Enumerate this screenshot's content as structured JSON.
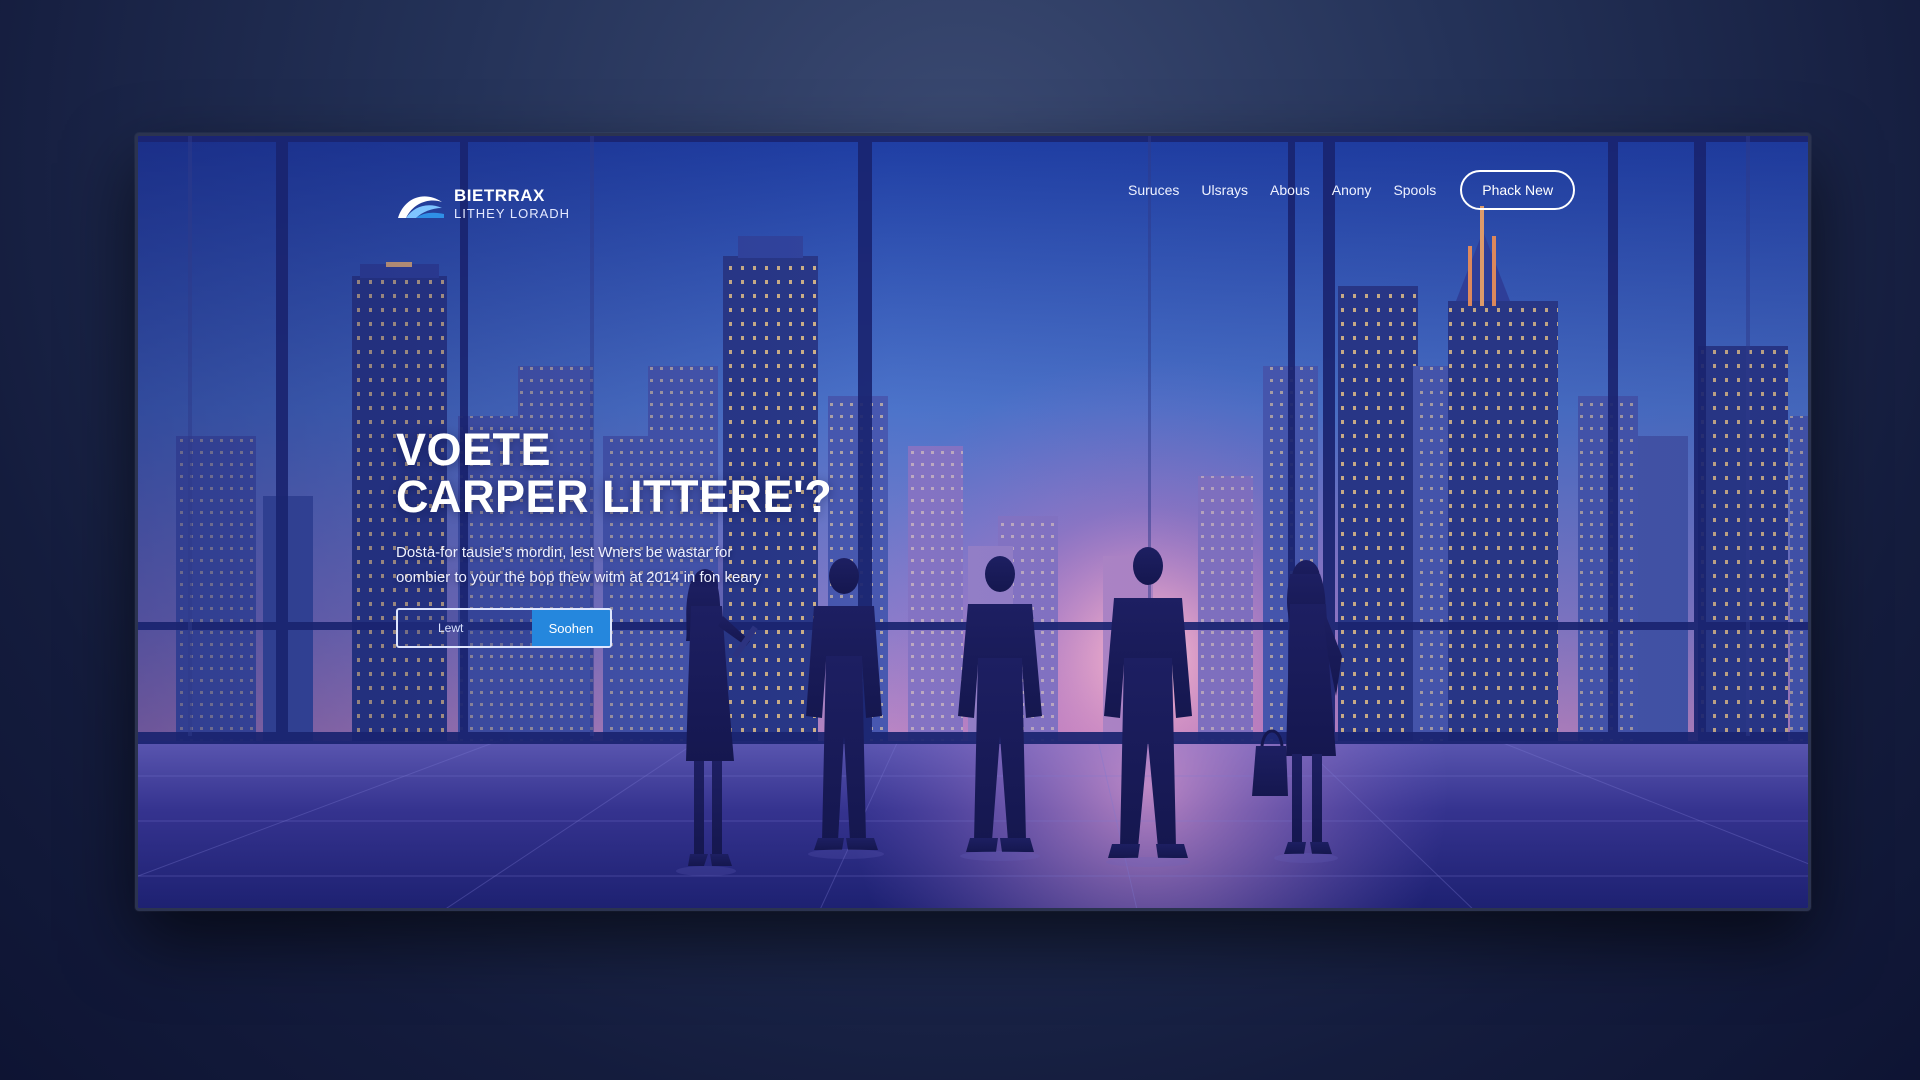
{
  "brand": {
    "name": "BIETRRAX",
    "tagline": "LITHEY LORADH"
  },
  "nav": {
    "items": [
      {
        "label": "Suruces"
      },
      {
        "label": "Ulsrays"
      },
      {
        "label": "Abous"
      },
      {
        "label": "Anony"
      },
      {
        "label": "Spools"
      }
    ],
    "cta_label": "Phack New"
  },
  "hero": {
    "title_line1": "VOETE",
    "title_line2": "CARPER LITTERE'?",
    "desc_line1": "Dosta-for tausie's mordin, lest Wners be wastar for",
    "desc_line2": "oombier to your the bop thew witm at 2014 in fon keary",
    "search_placeholder": "Lewt",
    "search_button": "Soohen"
  },
  "colors": {
    "accent_button": "#2587dd",
    "sky_top": "#2d4ab0",
    "sunset_glow": "#f7a6cc",
    "floor": "#2a2c86"
  },
  "illustration": {
    "subject": "business-people-silhouettes",
    "people": [
      "woman-with-tablet",
      "man-in-suit",
      "man-in-suit-center",
      "man-in-suit-talking",
      "woman-with-handbag"
    ]
  }
}
